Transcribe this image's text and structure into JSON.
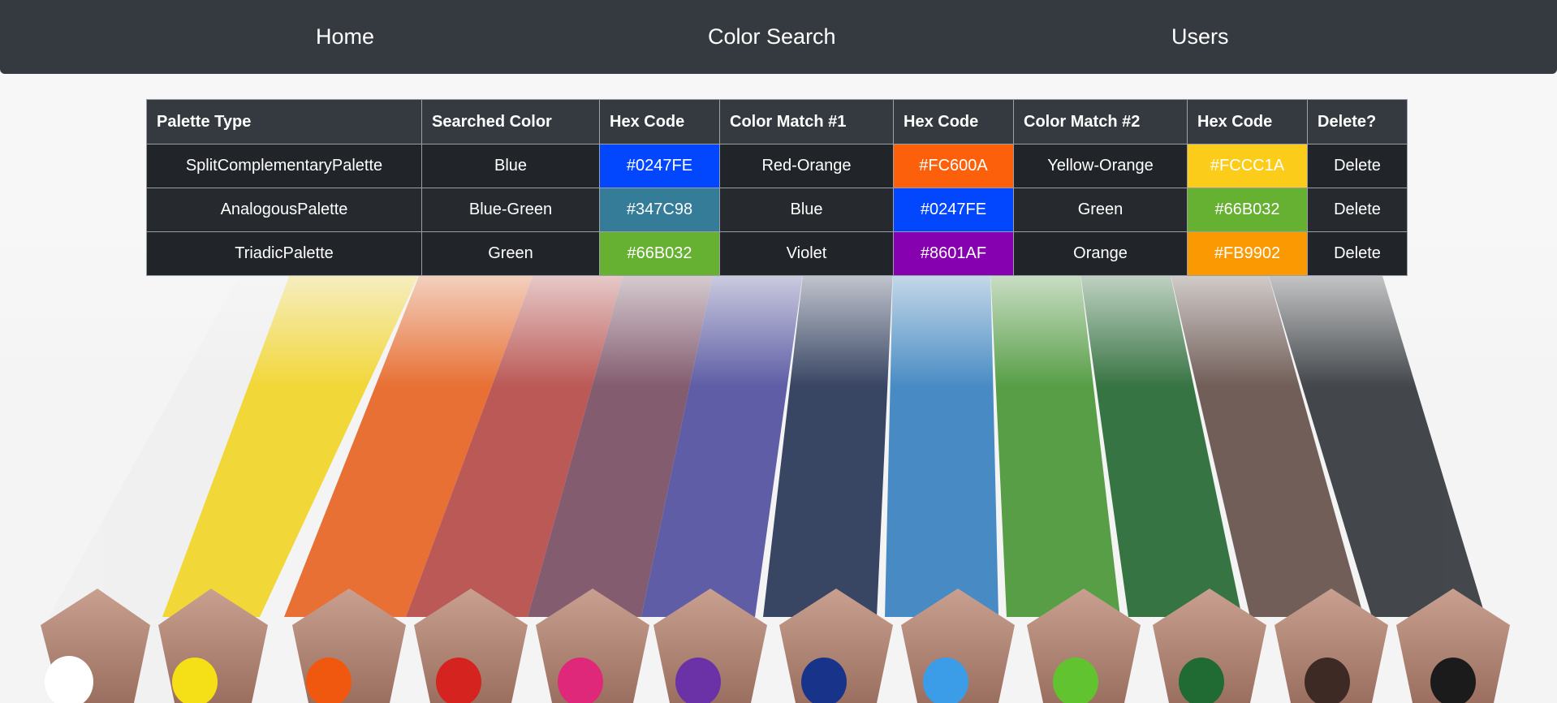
{
  "nav": {
    "home": "Home",
    "color_search": "Color Search",
    "users": "Users"
  },
  "table": {
    "headers": [
      "Palette Type",
      "Searched Color",
      "Hex Code",
      "Color Match #1",
      "Hex Code",
      "Color Match #2",
      "Hex Code",
      "Delete?"
    ],
    "rows": [
      {
        "palette_type": "SplitComplementaryPalette",
        "searched_color": "Blue",
        "searched_hex": "#0247FE",
        "match1": "Red-Orange",
        "match1_hex": "#FC600A",
        "match2": "Yellow-Orange",
        "match2_hex": "#FCCC1A",
        "delete": "Delete"
      },
      {
        "palette_type": "AnalogousPalette",
        "searched_color": "Blue-Green",
        "searched_hex": "#347C98",
        "match1": "Blue",
        "match1_hex": "#0247FE",
        "match2": "Green",
        "match2_hex": "#66B032",
        "delete": "Delete"
      },
      {
        "palette_type": "TriadicPalette",
        "searched_color": "Green",
        "searched_hex": "#66B032",
        "match1": "Violet",
        "match1_hex": "#8601AF",
        "match2": "Orange",
        "match2_hex": "#FB9902",
        "delete": "Delete"
      }
    ]
  },
  "colors": {
    "navbar": "#343a40",
    "header_cell": "#343a40",
    "body_cell": "#212529"
  },
  "background_image": "colored-pencils-photo"
}
